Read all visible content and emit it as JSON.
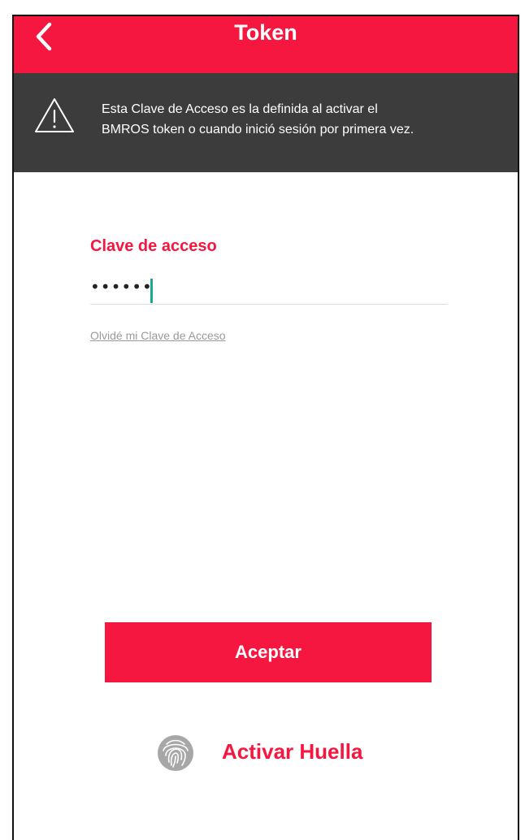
{
  "header": {
    "title": "Token",
    "back_icon": "chevron-left-icon",
    "background_color": "#f5173f"
  },
  "notice": {
    "icon": "warning-icon",
    "text_line1": "Esta Clave de Acceso es la definida al activar el",
    "text_line2": "BMROS token o cuando inició sesión por primera vez.",
    "background_color": "#3c3c3c"
  },
  "form": {
    "label": "Clave de acceso",
    "password_masked": "••••••",
    "forgot_link": "Olvidé mi Clave de Acceso"
  },
  "actions": {
    "accept_label": "Aceptar",
    "fingerprint_label": "Activar Huella",
    "fingerprint_icon": "fingerprint-icon"
  },
  "colors": {
    "accent": "#f5173f",
    "caret": "#1aa890"
  }
}
